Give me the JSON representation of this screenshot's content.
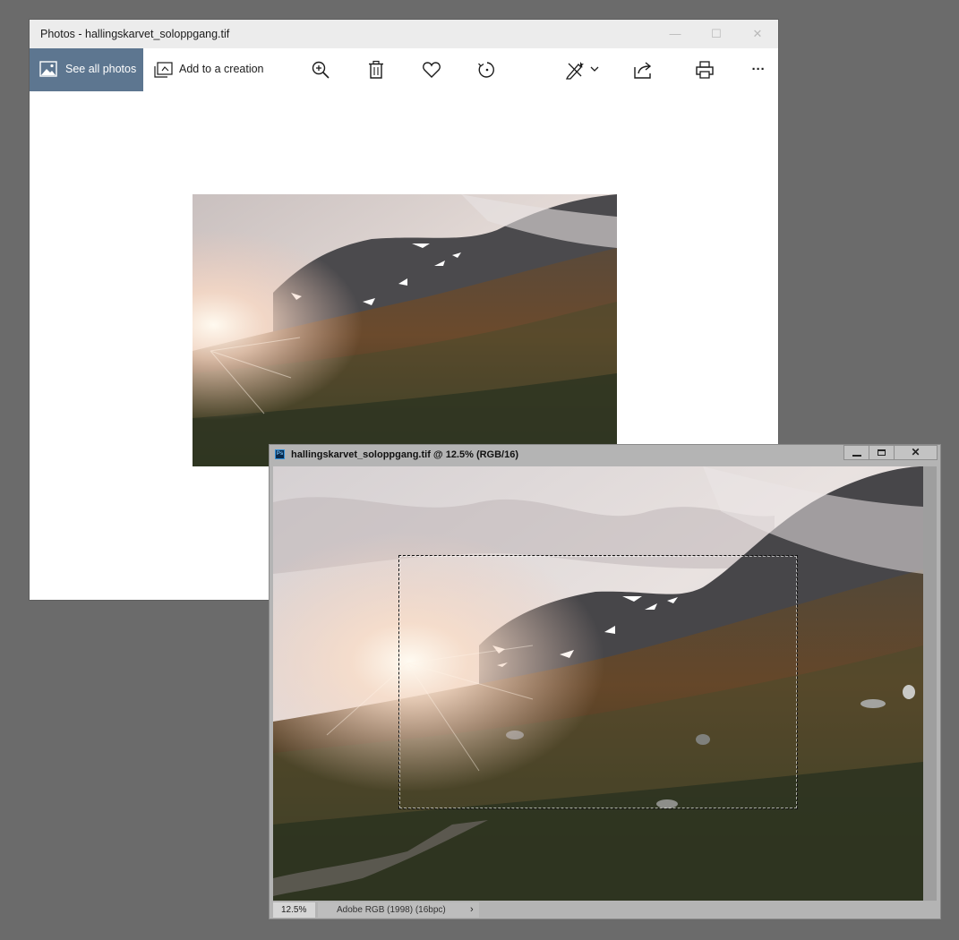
{
  "photos_app": {
    "window_title": "Photos - hallingskarvet_soloppgang.tif",
    "window_controls": {
      "minimize": "—",
      "maximize": "☐",
      "close": "✕"
    },
    "toolbar": {
      "see_all_photos": "See all photos",
      "add_to_creation": "Add to a creation",
      "more": "···"
    },
    "icons": [
      "photos-icon",
      "creation-icon",
      "zoom-in-icon",
      "delete-icon",
      "heart-icon",
      "rotate-icon",
      "edit-icon",
      "chevron-down-icon",
      "share-icon",
      "print-icon",
      "more-icon"
    ]
  },
  "photoshop_doc": {
    "window_title": "hallingskarvet_soloppgang.tif @ 12.5% (RGB/16)",
    "logo_text": "Ps",
    "window_controls": {
      "minimize": "▬",
      "maximize": "□",
      "close": "✕"
    },
    "status": {
      "zoom": "12.5%",
      "color_profile": "Adobe RGB (1998) (16bpc)",
      "arrow": "›"
    }
  },
  "colors": {
    "desktop": "#6b6b6b",
    "photos_accent": "#5d7690",
    "photoshop_chrome": "#b4b4b4"
  }
}
